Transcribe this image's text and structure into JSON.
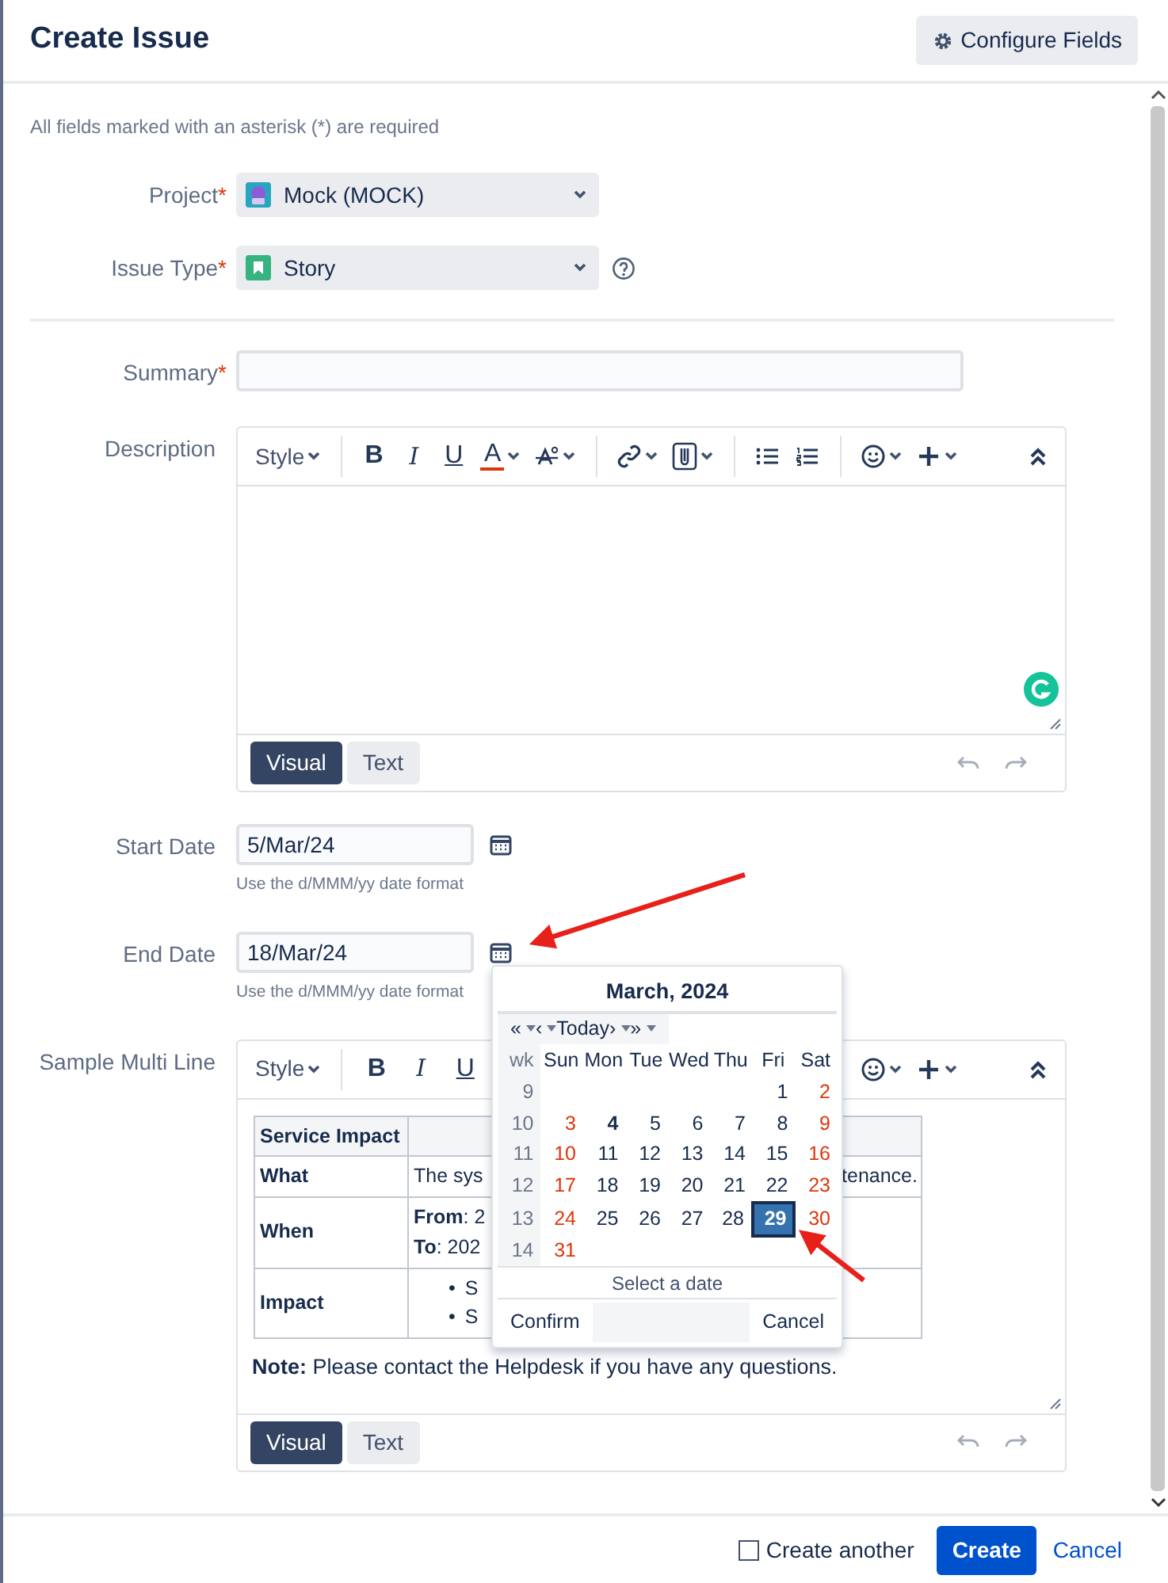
{
  "dialog": {
    "title": "Create Issue",
    "configure_button": "Configure Fields"
  },
  "required_note": "All fields marked with an asterisk (*) are required",
  "required_mark": "*",
  "fields": [
    {
      "kind": "select",
      "label": "Project",
      "required": true,
      "value": "Mock (MOCK)",
      "help": false
    },
    {
      "kind": "select",
      "label": "Issue Type",
      "required": true,
      "value": "Story",
      "help": true
    },
    {
      "kind": "divider"
    },
    {
      "kind": "text",
      "label": "Summary",
      "required": true
    },
    {
      "kind": "editor",
      "label": "Description",
      "required": false,
      "toolbar": [
        {
          "kind": "style",
          "label": "Style"
        },
        {
          "kind": "sep"
        },
        {
          "kind": "bold",
          "label": "B"
        },
        {
          "kind": "italic",
          "label": "I"
        },
        {
          "kind": "underline",
          "label": "U"
        },
        {
          "kind": "color",
          "label": "A"
        },
        {
          "kind": "effects"
        },
        {
          "kind": "sep"
        },
        {
          "kind": "link"
        },
        {
          "kind": "attach"
        },
        {
          "kind": "sep"
        },
        {
          "kind": "bullets"
        },
        {
          "kind": "numbers"
        },
        {
          "kind": "sep"
        },
        {
          "kind": "emoji"
        },
        {
          "kind": "insert"
        },
        {
          "kind": "collapse"
        }
      ],
      "modes": [
        {
          "label": "Visual",
          "selected": true
        },
        {
          "label": "Text",
          "selected": false
        }
      ]
    },
    {
      "kind": "date",
      "label": "Start Date",
      "required": false,
      "value": "5/Mar/24",
      "hint": "Use the d/MMM/yy date format",
      "picker_open": false
    },
    {
      "kind": "date",
      "label": "End Date",
      "required": false,
      "value": "18/Mar/24",
      "hint": "Use the d/MMM/yy date format",
      "picker_open": true
    },
    {
      "kind": "editor",
      "label": "Sample Multi Line",
      "required": false,
      "toolbar": [
        {
          "kind": "style",
          "label": "Style"
        },
        {
          "kind": "sep"
        },
        {
          "kind": "bold",
          "label": "B"
        },
        {
          "kind": "italic",
          "label": "I"
        },
        {
          "kind": "underline",
          "label": "U"
        },
        {
          "kind": "emoji"
        },
        {
          "kind": "insert"
        },
        {
          "kind": "collapse"
        }
      ],
      "content": {
        "table": [
          {
            "label": "Service Impact"
          },
          {
            "label": "What",
            "split": [
              "The sys",
              "tenance."
            ]
          },
          {
            "label": "When",
            "lines": [
              "**From**: 2",
              "**To**: 202"
            ]
          },
          {
            "label": "Impact",
            "marker": "•",
            "items": [
              "S",
              "S"
            ]
          }
        ],
        "note": "**Note:** Please contact the Helpdesk if you have any questions."
      },
      "modes": [
        {
          "label": "Visual",
          "selected": true
        },
        {
          "label": "Text",
          "selected": false
        }
      ]
    }
  ],
  "calendar": {
    "title": "March, 2024",
    "nav": [
      {
        "label": "«",
        "dropdown": true
      },
      {
        "label": "‹",
        "dropdown": true
      },
      {
        "label": "Today",
        "dropdown": false
      },
      {
        "label": "›",
        "dropdown": true
      },
      {
        "label": "»",
        "dropdown": true
      }
    ],
    "week_label": "wk",
    "weekdays": [
      "Sun",
      "Mon",
      "Tue",
      "Wed",
      "Thu",
      "Fri",
      "Sat"
    ],
    "weeks": [
      {
        "number": "9",
        "days": [
          {
            "label": "1",
            "today": false,
            "selected": false
          },
          {
            "label": "2",
            "today": false,
            "selected": false
          }
        ]
      },
      {
        "number": "10",
        "days": [
          {
            "label": "3",
            "today": false,
            "selected": false
          },
          {
            "label": "4",
            "today": true,
            "selected": false
          },
          {
            "label": "5",
            "today": false,
            "selected": false
          },
          {
            "label": "6",
            "today": false,
            "selected": false
          },
          {
            "label": "7",
            "today": false,
            "selected": false
          },
          {
            "label": "8",
            "today": false,
            "selected": false
          },
          {
            "label": "9",
            "today": false,
            "selected": false
          }
        ]
      },
      {
        "number": "11",
        "days": [
          {
            "label": "10",
            "today": false,
            "selected": false
          },
          {
            "label": "11",
            "today": false,
            "selected": false
          },
          {
            "label": "12",
            "today": false,
            "selected": false
          },
          {
            "label": "13",
            "today": false,
            "selected": false
          },
          {
            "label": "14",
            "today": false,
            "selected": false
          },
          {
            "label": "15",
            "today": false,
            "selected": false
          },
          {
            "label": "16",
            "today": false,
            "selected": false
          }
        ]
      },
      {
        "number": "12",
        "days": [
          {
            "label": "17",
            "today": false,
            "selected": false
          },
          {
            "label": "18",
            "today": false,
            "selected": false
          },
          {
            "label": "19",
            "today": false,
            "selected": false
          },
          {
            "label": "20",
            "today": false,
            "selected": false
          },
          {
            "label": "21",
            "today": false,
            "selected": false
          },
          {
            "label": "22",
            "today": false,
            "selected": false
          },
          {
            "label": "23",
            "today": false,
            "selected": false
          }
        ]
      },
      {
        "number": "13",
        "days": [
          {
            "label": "24",
            "today": false,
            "selected": false
          },
          {
            "label": "25",
            "today": false,
            "selected": false
          },
          {
            "label": "26",
            "today": false,
            "selected": false
          },
          {
            "label": "27",
            "today": false,
            "selected": false
          },
          {
            "label": "28",
            "today": false,
            "selected": false
          },
          {
            "label": "29",
            "today": false,
            "selected": true
          },
          {
            "label": "30",
            "today": false,
            "selected": false
          }
        ]
      },
      {
        "number": "14",
        "days": [
          {
            "label": "31",
            "today": false,
            "selected": false
          }
        ]
      }
    ],
    "status": "Select a date",
    "confirm": "Confirm",
    "cancel": "Cancel"
  },
  "footer": {
    "create_another": {
      "label": "Create another",
      "checked": false
    },
    "create": "Create",
    "cancel": "Cancel"
  }
}
